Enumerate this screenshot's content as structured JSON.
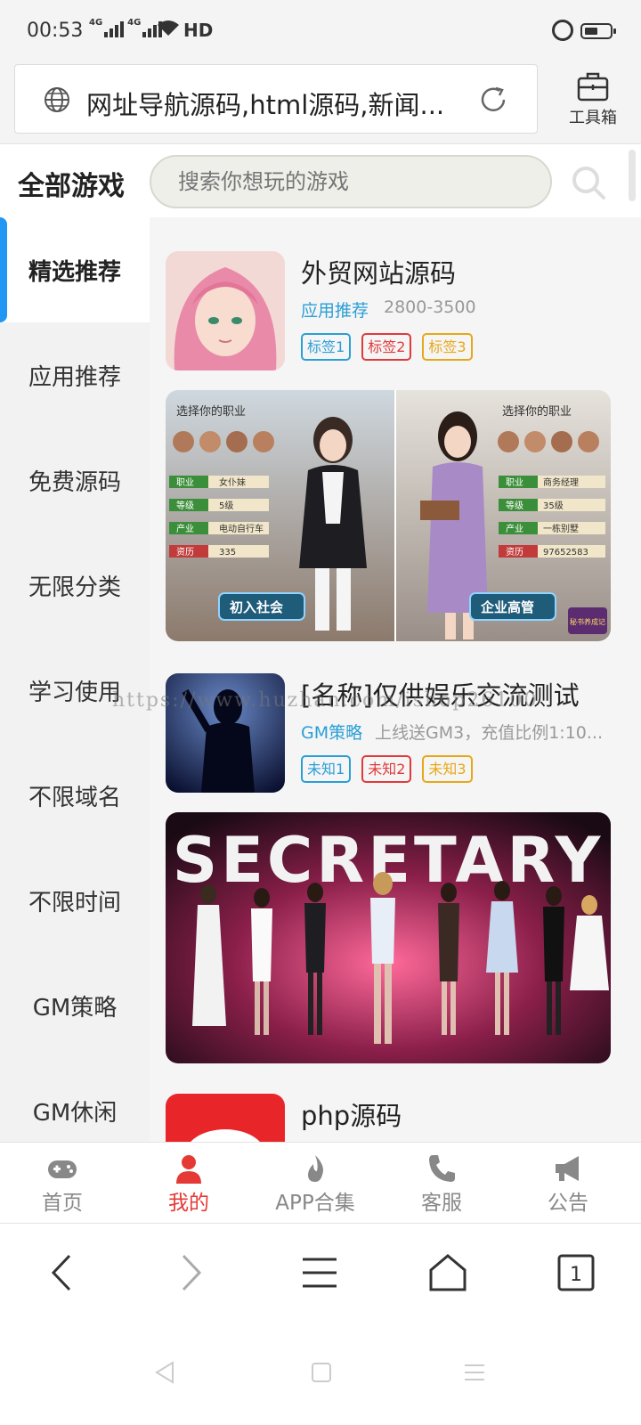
{
  "status_bar": {
    "time": "00:53",
    "network_1": "4G",
    "network_2": "4G",
    "hd_label": "HD",
    "icons": [
      "signal-icon",
      "wifi-icon",
      "alarm-icon",
      "battery-icon"
    ]
  },
  "browser": {
    "address_text": "网址导航源码,html源码,新闻...",
    "toolbox_label": "工具箱",
    "tab_count": "1"
  },
  "header": {
    "title": "全部游戏",
    "search_placeholder": "搜索你想玩的游戏"
  },
  "sidebar": {
    "active_index": 0,
    "items": [
      {
        "label": "精选推荐"
      },
      {
        "label": "应用推荐"
      },
      {
        "label": "免费源码"
      },
      {
        "label": "无限分类"
      },
      {
        "label": "学习使用"
      },
      {
        "label": "不限域名"
      },
      {
        "label": "不限时间"
      },
      {
        "label": "GM策略"
      },
      {
        "label": "GM休闲"
      }
    ]
  },
  "games": [
    {
      "title": "外贸网站源码",
      "category": "应用推荐",
      "desc": "2800-3500",
      "tags": [
        "标签1",
        "标签2",
        "标签3"
      ]
    },
    {
      "title": "[名称]仅供娱乐交流测试",
      "category": "GM策略",
      "desc": "上线送GM3，充值比例1:10...",
      "tags": [
        "未知1",
        "未知2",
        "未知3"
      ]
    },
    {
      "title": "php源码"
    }
  ],
  "banners": [
    {
      "left_heading": "选择你的职业",
      "right_heading": "选择你的职业",
      "left_rows": [
        {
          "k": "职业",
          "v": "女仆妹"
        },
        {
          "k": "等级",
          "v": "5级"
        },
        {
          "k": "产业",
          "v": "电动自行车"
        },
        {
          "k": "资历",
          "v": "335"
        }
      ],
      "right_rows": [
        {
          "k": "职业",
          "v": "商务经理"
        },
        {
          "k": "等级",
          "v": "35级"
        },
        {
          "k": "产业",
          "v": "一栋别墅"
        },
        {
          "k": "资历",
          "v": "97652583"
        }
      ],
      "left_badge": "初入社会",
      "right_badge": "企业高管",
      "corner_logo": "秘书养成记"
    },
    {
      "headline": "SECRETARY"
    }
  ],
  "watermark": "https://www.huzhan.com/ishop26100",
  "app_nav": [
    {
      "label": "首页",
      "icon": "gamepad-icon",
      "active": false
    },
    {
      "label": "我的",
      "icon": "user-icon",
      "active": true
    },
    {
      "label": "APP合集",
      "icon": "flame-icon",
      "active": false
    },
    {
      "label": "客服",
      "icon": "phone-icon",
      "active": false
    },
    {
      "label": "公告",
      "icon": "megaphone-icon",
      "active": false
    }
  ],
  "colors": {
    "accent_blue": "#2196f3",
    "category_blue": "#2a9fd6",
    "active_red": "#e53935",
    "tag_red": "#e03a3a",
    "tag_yellow": "#e6a817"
  }
}
